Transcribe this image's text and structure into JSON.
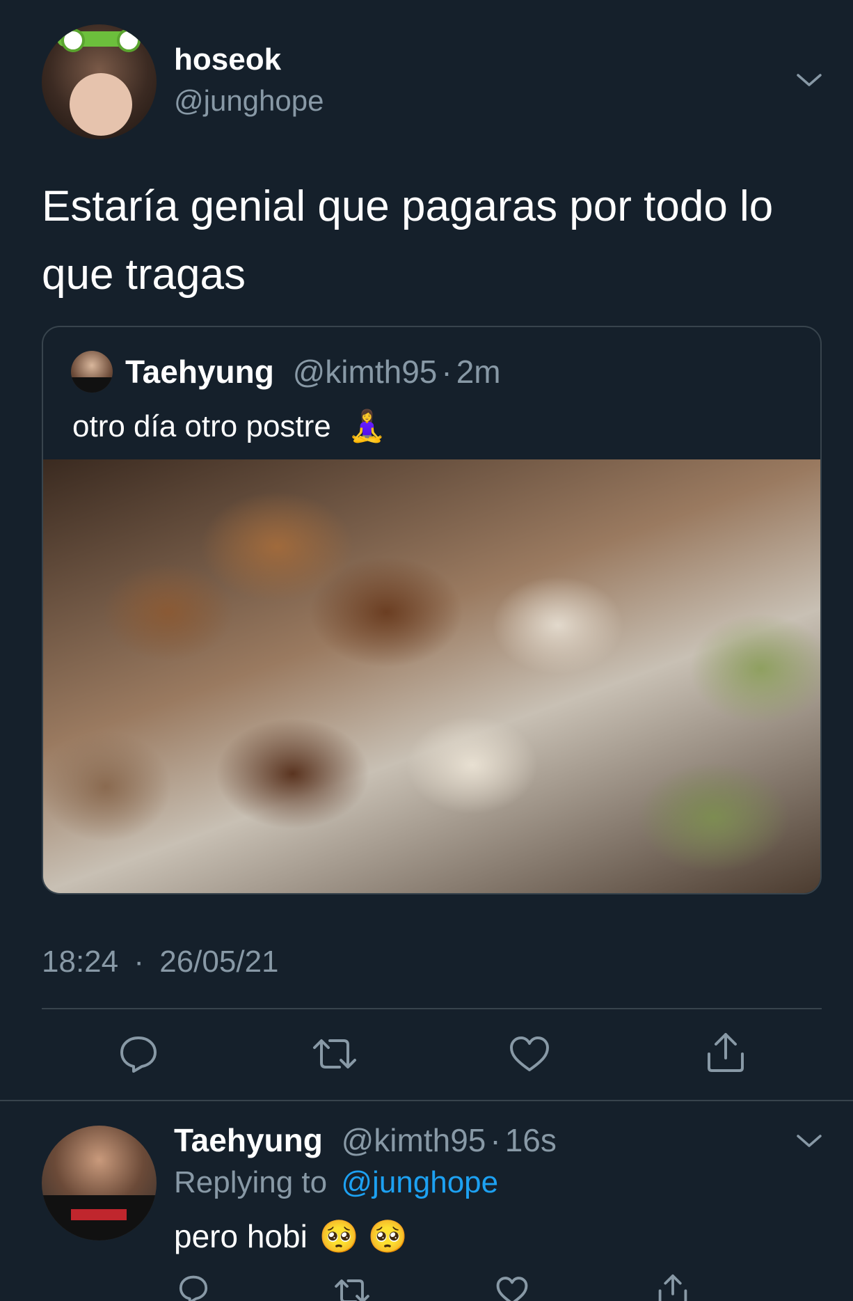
{
  "main_tweet": {
    "display_name": "hoseok",
    "handle": "@junghope",
    "text": "Estaría genial que pagaras por todo lo que tragas",
    "time": "18:24",
    "date": "26/05/21",
    "dot": "·"
  },
  "quoted_tweet": {
    "display_name": "Taehyung",
    "handle": "@kimth95",
    "dot": "·",
    "age": "2m",
    "text": "otro día otro postre",
    "emoji": "🧘‍♀️"
  },
  "reply": {
    "display_name": "Taehyung",
    "handle": "@kimth95",
    "dot": "·",
    "age": "16s",
    "replying_prefix": "Replying to",
    "replying_handle": "@junghope",
    "text": "pero hobi",
    "emoji": "🥺 🥺"
  },
  "icons": {
    "action_bar": [
      "reply-icon",
      "retweet-icon",
      "like-icon",
      "share-icon"
    ],
    "menu": "chevron-down-icon"
  },
  "colors": {
    "background": "#15202b",
    "secondary_text": "#8899a6",
    "link": "#1da1f2",
    "divider": "#38444d"
  }
}
